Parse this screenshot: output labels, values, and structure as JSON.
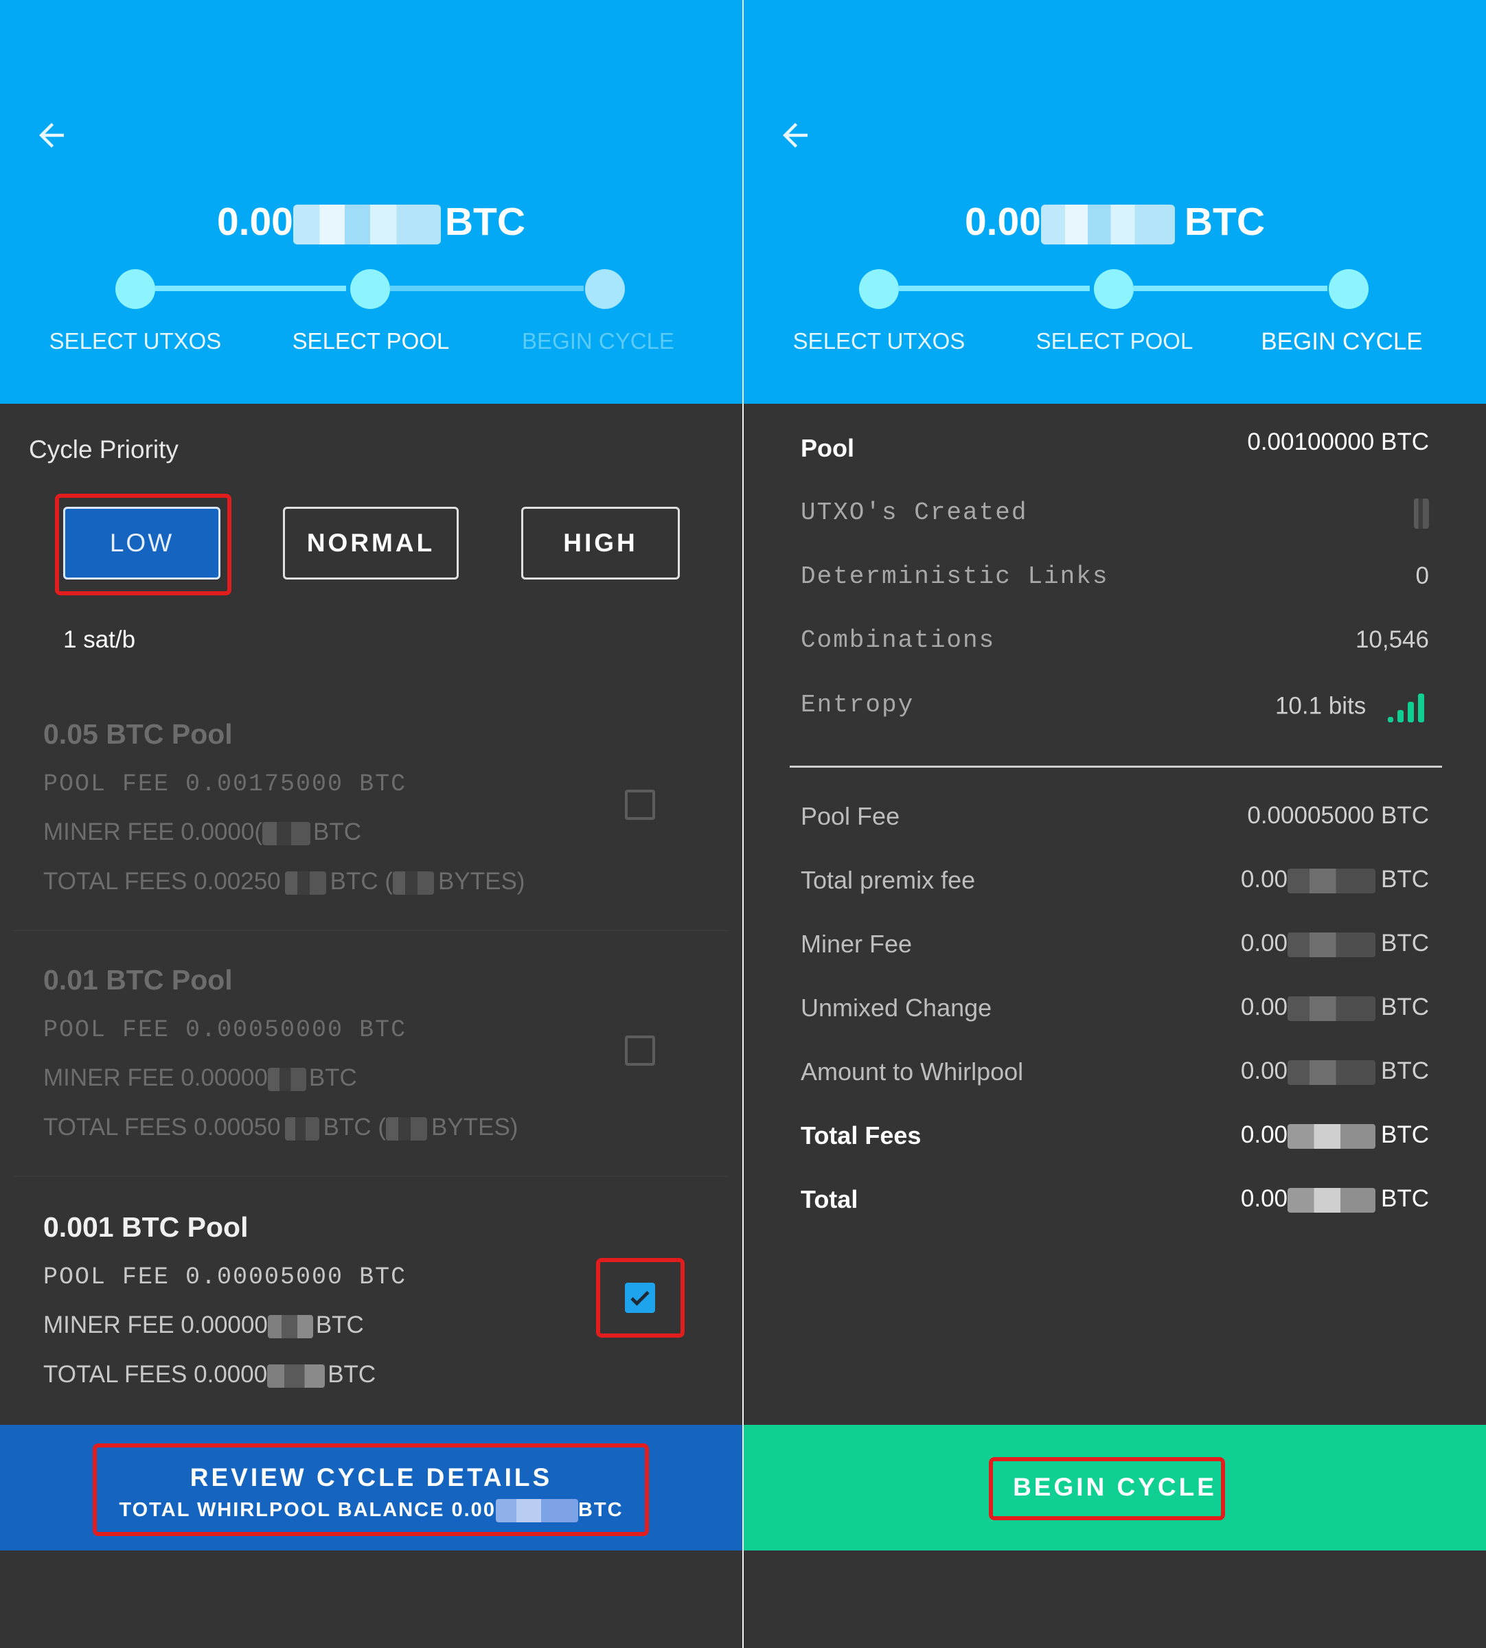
{
  "left": {
    "amount_prefix": "0.00",
    "amount_unit": "BTC",
    "steps": [
      "SELECT UTXOS",
      "SELECT POOL",
      "BEGIN CYCLE"
    ],
    "priority_label": "Cycle Priority",
    "priority_buttons": [
      "LOW",
      "NORMAL",
      "HIGH"
    ],
    "selected_priority": "LOW",
    "fee_rate": "1 sat/b",
    "pools": [
      {
        "title": "0.05 BTC Pool",
        "pool_fee": "POOL  FEE 0.00175000 BTC",
        "miner_fee_prefix": "MINER FEE  0.0000(",
        "miner_fee_unit": "BTC",
        "total_fees_prefix": "TOTAL FEES  0.00250",
        "total_fees_mid": "BTC (",
        "total_fees_suffix": "BYTES)",
        "checked": false
      },
      {
        "title": "0.01 BTC Pool",
        "pool_fee": "POOL  FEE 0.00050000 BTC",
        "miner_fee_prefix": "MINER FEE  0.00000",
        "miner_fee_unit": "BTC",
        "total_fees_prefix": "TOTAL FEES  0.00050",
        "total_fees_mid": "BTC (",
        "total_fees_suffix": "BYTES)",
        "checked": false
      },
      {
        "title": "0.001 BTC Pool",
        "pool_fee": "POOL  FEE 0.00005000 BTC",
        "miner_fee_prefix": "MINER FEE  0.00000",
        "miner_fee_unit": "BTC",
        "total_fees_prefix": "TOTAL FEES  0.0000",
        "total_fees_unit": "BTC",
        "checked": true
      }
    ],
    "review_button": "REVIEW CYCLE DETAILS",
    "review_balance_prefix": "TOTAL WHIRLPOOL BALANCE 0.00",
    "review_balance_unit": "BTC"
  },
  "right": {
    "amount_prefix": "0.00",
    "amount_unit": "BTC",
    "steps": [
      "SELECT UTXOS",
      "SELECT POOL",
      "BEGIN CYCLE"
    ],
    "pool_label": "Pool",
    "pool_value": "0.00100000 BTC",
    "utxos_created_label": "UTXO's Created",
    "deterministic_links_label": "Deterministic Links",
    "deterministic_links_value": "0",
    "combinations_label": "Combinations",
    "combinations_value": "10,546",
    "entropy_label": "Entropy",
    "entropy_value": "10.1 bits",
    "pool_fee_label": "Pool Fee",
    "pool_fee_value": "0.00005000 BTC",
    "total_premix_fee_label": "Total premix fee",
    "miner_fee_label": "Miner Fee",
    "unmixed_change_label": "Unmixed Change",
    "amount_to_whirlpool_label": "Amount to Whirlpool",
    "total_fees_label": "Total Fees",
    "total_label": "Total",
    "masked_value_prefix": "0.00",
    "masked_value_unit": "BTC",
    "begin_button": "BEGIN CYCLE"
  },
  "colors": {
    "header_blue": "#03a9f4",
    "step_dot": "#8cf3ff",
    "review_button": "#1565c0",
    "begin_button": "#10cf92",
    "highlight_red": "#e21d1d",
    "entropy_icon": "#10cf92",
    "background": "#343434"
  }
}
